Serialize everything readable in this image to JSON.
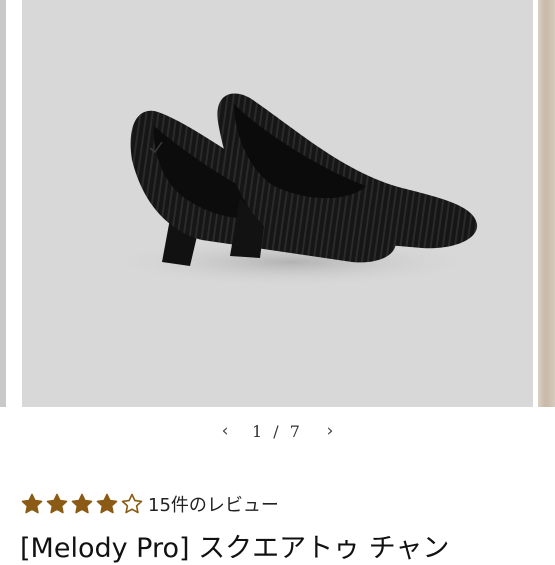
{
  "colors": {
    "star_fill": "#8b5a14",
    "gallery_bg": "#d8d8d8",
    "text": "#222222"
  },
  "gallery": {
    "image_alt": "black knit square-toe pumps",
    "current": "1",
    "separator": "/",
    "total": "7",
    "prev_icon": "chevron-left-icon",
    "next_icon": "chevron-right-icon"
  },
  "rating": {
    "stars_filled": 4,
    "stars_total": 5,
    "review_text": "15件のレビュー"
  },
  "product": {
    "title": "[Melody Pro] スクエアトゥ チャン"
  }
}
